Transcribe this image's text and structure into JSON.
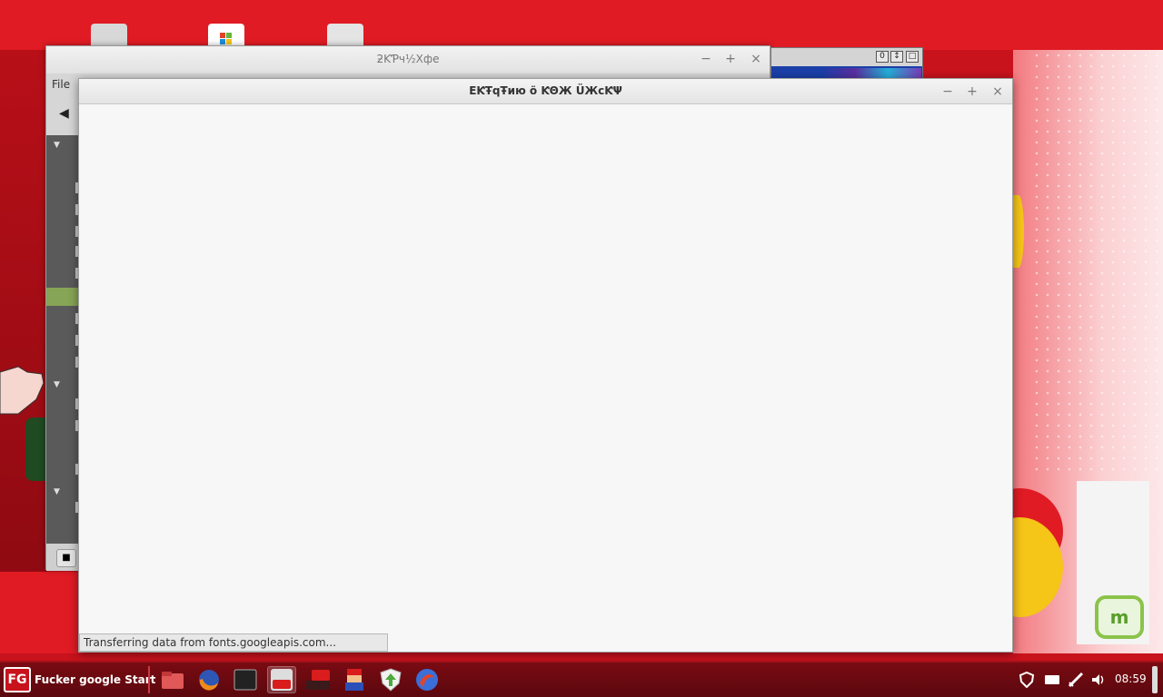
{
  "desktop": {
    "background_color": "#e01b24",
    "mint_logo": "m"
  },
  "back_window": {
    "title": "ƻƘƤч½Хфе",
    "menu_file": "File",
    "sidebar_sections": [
      "▼",
      "▼",
      "▼"
    ]
  },
  "peek_window": {
    "buttons": [
      "0",
      "↕",
      "□"
    ]
  },
  "front_window": {
    "title": "ЕƘŦqŦию    ö ƘΘЖ ÜЖсƘΨ",
    "status_text": "Transferring data from fonts.googleapis.com..."
  },
  "taskbar": {
    "start_label": "Fucker google Start",
    "start_logo_text": "FG",
    "launchers": [
      {
        "name": "files",
        "icon": "folder-icon"
      },
      {
        "name": "firefox",
        "icon": "firefox-icon"
      },
      {
        "name": "terminal",
        "icon": "terminal-icon"
      },
      {
        "name": "youtube",
        "icon": "youtube-icon"
      },
      {
        "name": "youtube-dl",
        "icon": "youtube-download-icon"
      },
      {
        "name": "mario",
        "icon": "mario-icon"
      },
      {
        "name": "update-manager",
        "icon": "update-shield-icon"
      },
      {
        "name": "web-browser",
        "icon": "browser-globe-icon"
      }
    ],
    "youtube_text": "You Tube",
    "terminal_text": ">_",
    "clock": "08:59"
  },
  "colors": {
    "accent": "#e01b24",
    "taskbar": "#6a0a10",
    "selection": "#87a556"
  }
}
